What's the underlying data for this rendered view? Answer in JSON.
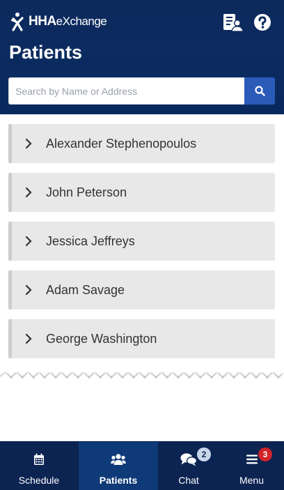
{
  "app": {
    "brand_main": "HHA",
    "brand_rest": "eXchange",
    "icons": {
      "patient_profile": "patient-card-icon",
      "help": "question-circle-icon"
    }
  },
  "page": {
    "title": "Patients"
  },
  "search": {
    "placeholder": "Search by Name or Address",
    "value": "",
    "icon": "search-icon"
  },
  "patients": [
    {
      "name": "Alexander Stephenopoulos"
    },
    {
      "name": "John Peterson"
    },
    {
      "name": "Jessica Jeffreys"
    },
    {
      "name": "Adam Savage"
    },
    {
      "name": "George Washington"
    }
  ],
  "nav": {
    "items": [
      {
        "label": "Schedule",
        "icon": "calendar-icon",
        "active": false
      },
      {
        "label": "Patients",
        "icon": "users-icon",
        "active": true
      },
      {
        "label": "Chat",
        "icon": "chat-bubbles-icon",
        "active": false,
        "badge": "2"
      },
      {
        "label": "Menu",
        "icon": "hamburger-icon",
        "active": false,
        "badge": "3"
      }
    ]
  },
  "colors": {
    "header_bg": "#0b2b60",
    "nav_bg": "#0c2452",
    "nav_active_bg": "#0f3a78",
    "search_button": "#2b5bb8",
    "list_item_bg": "#e8e8e8",
    "badge_alert": "#d0232a"
  }
}
